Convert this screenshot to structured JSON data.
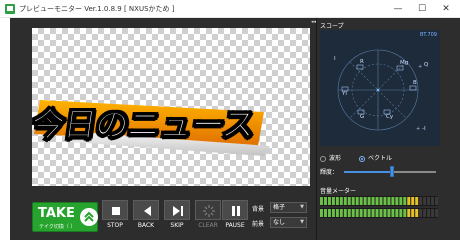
{
  "window": {
    "title": "プレビューモニター Ver.1.0.8.9 [ NXUSかため ]",
    "minimize_icon": "minimize-icon",
    "maximize_icon": "maximize-icon",
    "close_icon": "close-icon"
  },
  "preview": {
    "overlay_text": "今日のニュース"
  },
  "controls": {
    "take": {
      "label": "TAKE",
      "sublabel": "テイク切換（ ）"
    },
    "buttons": [
      {
        "id": "stop",
        "label": "STOP",
        "icon": "stop-icon",
        "enabled": true
      },
      {
        "id": "back",
        "label": "BACK",
        "icon": "back-icon",
        "enabled": true
      },
      {
        "id": "skip",
        "label": "SKIP",
        "icon": "skip-icon",
        "enabled": true
      },
      {
        "id": "clear",
        "label": "CLEAR",
        "icon": "clear-icon",
        "enabled": false
      },
      {
        "id": "pause",
        "label": "PAUSE",
        "icon": "pause-icon",
        "enabled": true
      }
    ],
    "background_select": {
      "label": "背景",
      "value": "格子"
    },
    "foreground_select": {
      "label": "前景",
      "value": "なし"
    }
  },
  "scope": {
    "title": "スコープ",
    "standard": "BT.709",
    "targets": [
      "R",
      "Mg",
      "B",
      "Cy",
      "G",
      "Yl"
    ],
    "axis_labels": [
      "Q",
      "-I",
      "I"
    ],
    "mode_options": [
      {
        "label": "波形",
        "selected": false
      },
      {
        "label": "ベクトル",
        "selected": true
      }
    ],
    "brightness_label": "輝度：",
    "brightness_level": 0.52
  },
  "audio_meter": {
    "title": "音量メーター",
    "channels": [
      {
        "name": "L",
        "level": 0.82
      },
      {
        "name": "R",
        "level": 0.82
      }
    ]
  },
  "colors": {
    "take_green": "#26a42e",
    "panel_bg": "#2d2d2d",
    "scope_bg": "#1d2b3a",
    "accent_blue": "#4a90e2"
  }
}
